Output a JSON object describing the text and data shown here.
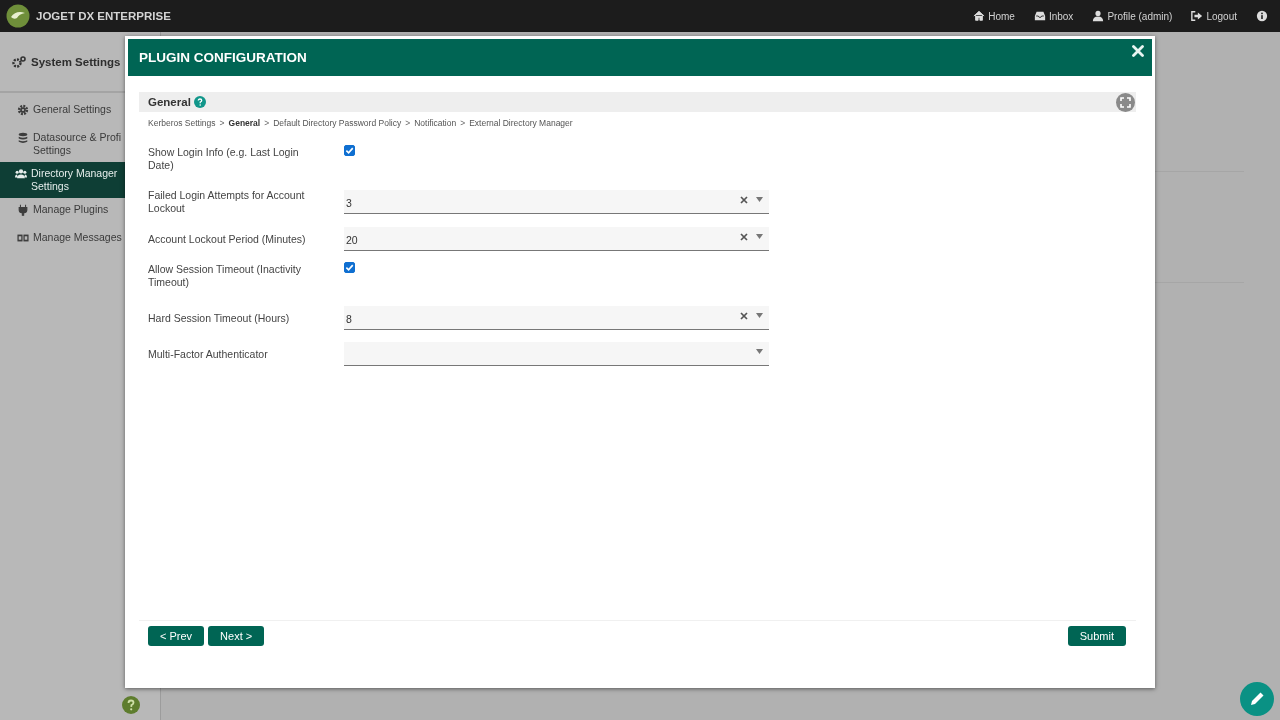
{
  "top_bar": {
    "brand": "JOGET DX ENTERPRISE",
    "links": [
      {
        "kind": "home",
        "label": "Home"
      },
      {
        "kind": "inbox",
        "label": "Inbox"
      },
      {
        "kind": "user",
        "label": "Profile (admin)"
      },
      {
        "kind": "logout",
        "label": "Logout"
      },
      {
        "kind": "info"
      }
    ]
  },
  "sidebar": {
    "title": "System Settings",
    "items": [
      {
        "kind": "gear",
        "label": "General Settings",
        "selected": false
      },
      {
        "kind": "database",
        "label": "Datasource & Profi\nSettings",
        "selected": false
      },
      {
        "kind": "users",
        "label": "Directory Manager\nSettings",
        "selected": true
      },
      {
        "kind": "plug",
        "label": "Manage Plugins",
        "selected": false
      },
      {
        "kind": "messages",
        "label": "Manage Messages",
        "selected": false
      }
    ]
  },
  "dialog": {
    "title": "PLUGIN CONFIGURATION",
    "section": "General",
    "separator": ">",
    "steps": [
      {
        "label": "Kerberos Settings",
        "selected": false
      },
      {
        "label": "General",
        "selected": true
      },
      {
        "label": "Default Directory Password Policy",
        "selected": false
      },
      {
        "label": "Notification",
        "selected": false
      },
      {
        "label": "External Directory Manager",
        "selected": false
      }
    ],
    "fields": [
      {
        "kind": "checkbox",
        "label": "Show Login Info (e.g. Last Login Date)",
        "checked": true
      },
      {
        "kind": "select",
        "label": "Failed Login Attempts for Account Lockout",
        "value": "3",
        "clearable": true
      },
      {
        "kind": "select",
        "label": "Account Lockout Period (Minutes)",
        "value": "20",
        "clearable": true
      },
      {
        "kind": "checkbox",
        "label": "Allow Session Timeout (Inactivity Timeout)",
        "checked": true
      },
      {
        "kind": "select",
        "label": "Hard Session Timeout (Hours)",
        "value": "8",
        "clearable": true
      },
      {
        "kind": "select",
        "label": "Multi-Factor Authenticator",
        "clearable": false
      }
    ],
    "buttons_left": [
      "< Prev",
      "Next >"
    ],
    "submit": "Submit"
  }
}
